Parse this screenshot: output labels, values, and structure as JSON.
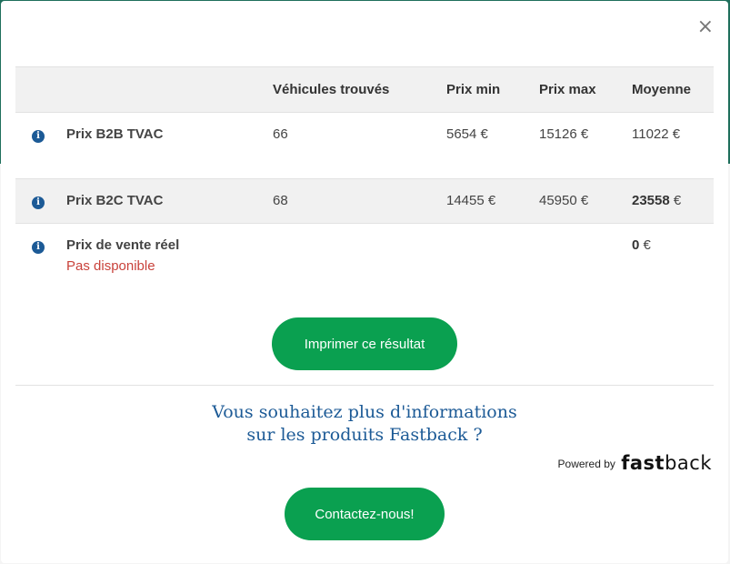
{
  "modal": {
    "close_label": "×"
  },
  "table": {
    "headers": [
      "",
      "",
      "Véhicules trouvés",
      "Prix min",
      "Prix max",
      "Moyenne"
    ],
    "rows": [
      {
        "label": "Prix B2B TVAC",
        "found": "66",
        "min": "5654 €",
        "max": "15126 €",
        "avg": "11022 €"
      },
      {
        "label": "Prix B2C TVAC",
        "found": "68",
        "min": "14455 €",
        "max": "45950 €",
        "avg_value": "23558",
        "avg_unit": " €"
      },
      {
        "label": "Prix de vente réel",
        "status": "Pas disponible",
        "avg_value": "0",
        "avg_unit": " €"
      }
    ],
    "info_icon": "i"
  },
  "actions": {
    "print_label": "Imprimer ce résultat",
    "contact_label": "Contactez-nous!"
  },
  "promo": {
    "line1": "Vous souhaitez plus d'informations",
    "line2": "sur les produits Fastback ?"
  },
  "powered": {
    "label": "Powered by",
    "brand_bold": "fast",
    "brand_rest": "back"
  },
  "colors": {
    "accent": "#0aa050",
    "link_blue": "#1c5a96",
    "error_red": "#c9423b"
  }
}
